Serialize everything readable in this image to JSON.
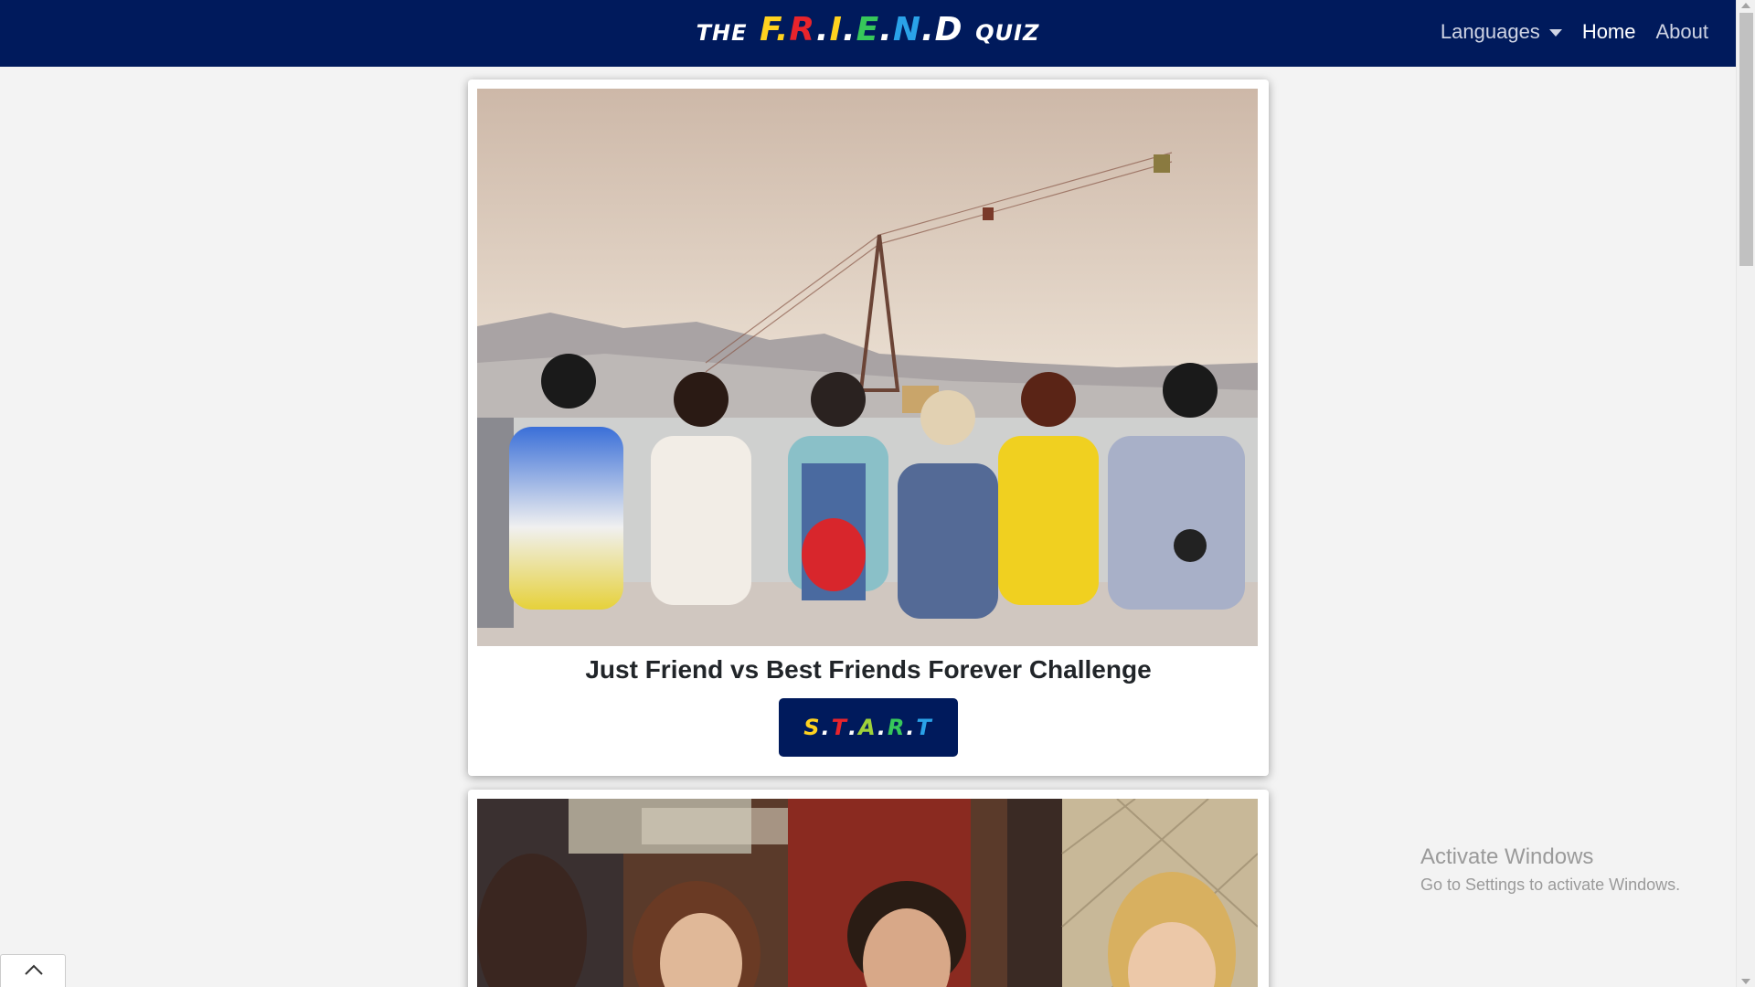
{
  "navbar": {
    "brand_prefix": "THE",
    "brand_letters": [
      {
        "char": "F",
        "color": "#ffd21f"
      },
      {
        "char": ".",
        "color": "#ffd21f"
      },
      {
        "char": "R",
        "color": "#e8242c"
      },
      {
        "char": ".",
        "color": "#ffffff"
      },
      {
        "char": "I",
        "color": "#ffd21f"
      },
      {
        "char": ".",
        "color": "#ffffff"
      },
      {
        "char": "E",
        "color": "#37c85a"
      },
      {
        "char": ".",
        "color": "#ffffff"
      },
      {
        "char": "N",
        "color": "#2aa2e8"
      },
      {
        "char": ".",
        "color": "#ffffff"
      },
      {
        "char": "D",
        "color": "#ffffff"
      }
    ],
    "brand_suffix": "QUIZ",
    "languages_label": "Languages",
    "home_label": "Home",
    "about_label": "About"
  },
  "cards": [
    {
      "title": "Just Friend vs Best Friends Forever Challenge",
      "image": "photo-friends-sitting-by-sea-with-cable-cars",
      "button_letters": [
        {
          "char": "S",
          "color": "#ffd21f"
        },
        {
          "char": ".",
          "color": "#ffffff"
        },
        {
          "char": "T",
          "color": "#e8242c"
        },
        {
          "char": ".",
          "color": "#ffffff"
        },
        {
          "char": "A",
          "color": "#9fd23a"
        },
        {
          "char": ".",
          "color": "#ffffff"
        },
        {
          "char": "R",
          "color": "#37c85a"
        },
        {
          "char": ".",
          "color": "#ffffff"
        },
        {
          "char": "T",
          "color": "#2aa2e8"
        }
      ]
    },
    {
      "image": "photo-friends-laughing-in-pub"
    }
  ],
  "watermark": {
    "line1": "Activate Windows",
    "line2": "Go to Settings to activate Windows."
  },
  "icons": {
    "dropdown": "caret-down-icon",
    "scroll_top": "chevron-up-icon"
  }
}
